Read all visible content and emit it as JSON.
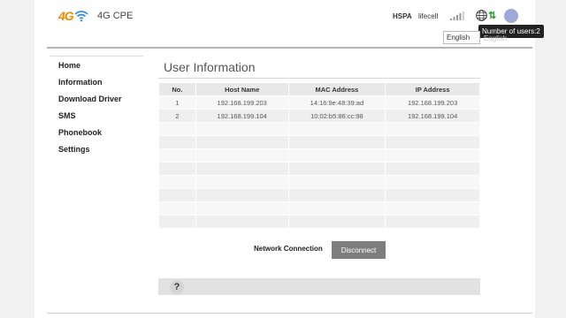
{
  "header": {
    "logo_4g": "4G",
    "product": "4G CPE",
    "network_type": "HSPA",
    "operator": "lifecell",
    "tooltip": "Number of users:2",
    "arrows": "⇅",
    "language": "English",
    "language_ghost": "English"
  },
  "nav": {
    "items": [
      {
        "label": "Home"
      },
      {
        "label": "Information"
      },
      {
        "label": "Download Driver"
      },
      {
        "label": "SMS"
      },
      {
        "label": "Phonebook"
      },
      {
        "label": "Settings"
      }
    ]
  },
  "main": {
    "title": "User Information",
    "table": {
      "headers": [
        "No.",
        "Host Name",
        "MAC Address",
        "IP Address"
      ],
      "rows": [
        [
          "1",
          "192.168.199.203",
          "14:16:9e:48:39:ad",
          "192.168.199.203"
        ],
        [
          "2",
          "192.168.199.104",
          "10:02:b5:86:cc:98",
          "192.168.199.104"
        ]
      ],
      "empty_rows": 8
    },
    "network_connection_label": "Network Connection",
    "disconnect_label": "Disconnect",
    "help_icon": "?"
  },
  "icons": {
    "wifi": "wifi-icon",
    "signal": "signal-icon",
    "globe": "globe-icon",
    "users": "users-icon"
  },
  "colors": {
    "brand_orange": "#f08a00",
    "wifi_blue": "#2f8fd8",
    "arrows_green": "#2a9a2a",
    "users_icon": "#9fa9d8",
    "button_gray": "#7e7e7e"
  }
}
